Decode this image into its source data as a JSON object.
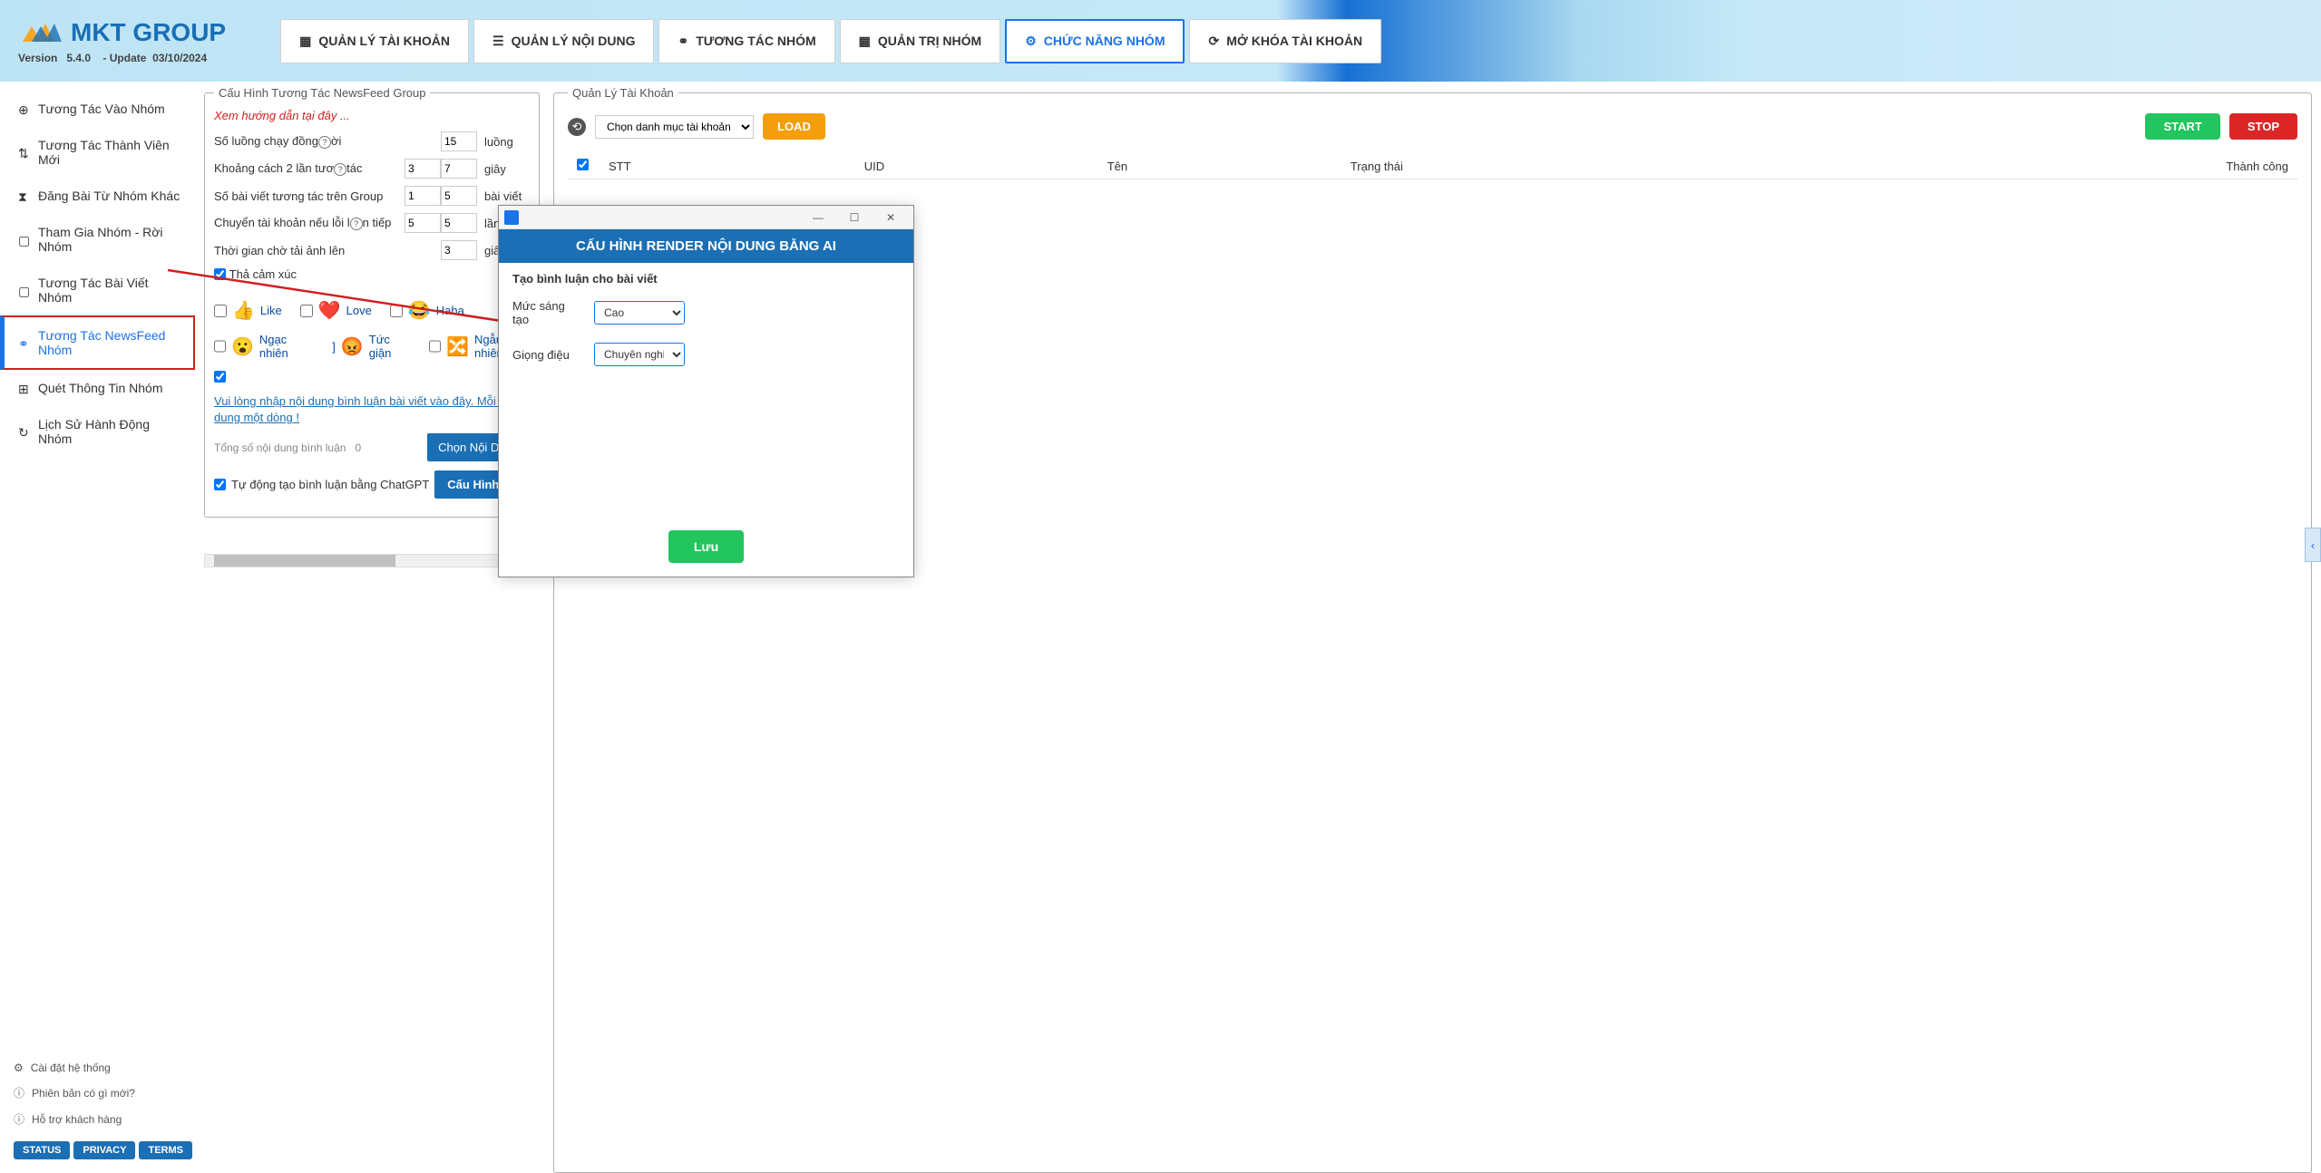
{
  "app": {
    "name": "MKT GROUP",
    "version_label": "Version",
    "version": "5.4.0",
    "update_label": "- Update",
    "update_date": "03/10/2024"
  },
  "nav": [
    {
      "icon": "account",
      "label": "QUẢN LÝ TÀI KHOẢN"
    },
    {
      "icon": "content",
      "label": "QUẢN LÝ NỘI DUNG"
    },
    {
      "icon": "interact",
      "label": "TƯƠNG TÁC NHÓM"
    },
    {
      "icon": "admin",
      "label": "QUẢN TRỊ NHÓM"
    },
    {
      "icon": "function",
      "label": "CHỨC NĂNG NHÓM",
      "active": true
    },
    {
      "icon": "unlock",
      "label": "MỞ KHÓA TÀI KHOẢN"
    }
  ],
  "sidebar": {
    "items": [
      {
        "icon": "plus-circle",
        "label": "Tương Tác Vào Nhóm"
      },
      {
        "icon": "swap",
        "label": "Tương Tác Thành Viên Mới"
      },
      {
        "icon": "hourglass",
        "label": "Đăng Bài Từ Nhóm Khác"
      },
      {
        "icon": "doc",
        "label": "Tham Gia Nhóm - Rời Nhóm"
      },
      {
        "icon": "doc",
        "label": "Tương Tác Bài Viết Nhóm"
      },
      {
        "icon": "interact",
        "label": "Tương Tác NewsFeed Nhóm",
        "active": true
      },
      {
        "icon": "scan",
        "label": "Quét Thông Tin Nhóm"
      },
      {
        "icon": "history",
        "label": "Lịch Sử Hành Động Nhóm"
      }
    ],
    "bottom": [
      {
        "icon": "gear",
        "label": "Cài đặt hệ thống"
      },
      {
        "icon": "info",
        "label": "Phiên bản có gì mới?"
      },
      {
        "icon": "help",
        "label": "Hỗ trợ khách hàng"
      }
    ],
    "badges": [
      "STATUS",
      "PRIVACY",
      "TERMS"
    ]
  },
  "config_panel": {
    "title": "Cấu Hình Tương Tác NewsFeed Group",
    "hint": "Xem hướng dẫn tại đây ...",
    "rows": [
      {
        "label": "Số luồng chạy đồng",
        "suffix_label": "ời",
        "v1": "15",
        "unit": "luồng",
        "single": true
      },
      {
        "label": "Khoảng cách 2 lần tươ",
        "suffix_label": "tác",
        "v1": "3",
        "v2": "7",
        "unit": "giây"
      },
      {
        "label": "Số bài viết tương tác trên Group",
        "v1": "1",
        "v2": "5",
        "unit": "bài viết"
      },
      {
        "label": "Chuyển tài khoản nếu lỗi l",
        "suffix_label": "n tiếp",
        "v1": "5",
        "v2": "5",
        "unit": "lần"
      },
      {
        "label": "Thời gian chờ tải ảnh lên",
        "v1": "3",
        "unit": "giây",
        "single": true
      }
    ],
    "emoji_checkbox": "Thả cảm xúc",
    "reactions": [
      {
        "emoji": "👍",
        "label": "Like"
      },
      {
        "emoji": "❤️",
        "label": "Love"
      },
      {
        "emoji": "😂",
        "label": "Haha"
      },
      {
        "emoji": "😮",
        "label": "Ngạc nhiên"
      },
      {
        "emoji": "😡",
        "label": "Tức giận"
      },
      {
        "emoji": "🔀",
        "label": "Ngẫu nhiên"
      }
    ],
    "comment_link": "Vui lòng nhập nội dung bình luận bài viết vào đây. Mỗi nội dung một dòng !",
    "total_label": "Tổng số nội dung bình luận",
    "total_value": "0",
    "choose_button": "Chọn Nội Dung",
    "auto_gpt": "Tự động tạo bình luận bằng ChatGPT",
    "config_button": "Cấu Hình"
  },
  "account_panel": {
    "title": "Quản Lý Tài Khoản",
    "category_placeholder": "Chọn danh mục tài khoản",
    "load_button": "LOAD",
    "start_button": "START",
    "stop_button": "STOP",
    "columns": [
      "STT",
      "UID",
      "Tên",
      "Trạng thái",
      "Thành công"
    ]
  },
  "dialog": {
    "title": "CẤU HÌNH RENDER NỘI DUNG BẰNG AI",
    "subtitle": "Tạo bình luận cho bài viết",
    "creativity_label": "Mức sáng tạo",
    "creativity_value": "Cao",
    "tone_label": "Giọng điệu",
    "tone_value": "Chuyên nghiệp",
    "save_button": "Lưu"
  }
}
